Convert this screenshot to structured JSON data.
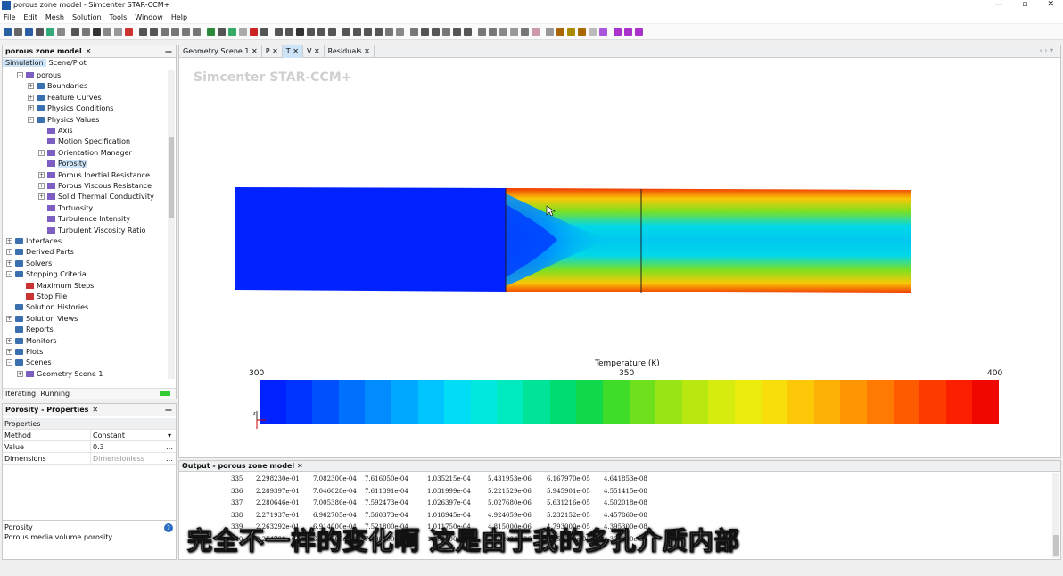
{
  "window": {
    "title": "porous zone model - Simcenter STAR-CCM+",
    "controls": [
      "—",
      "▫",
      "✕"
    ]
  },
  "menu": [
    "File",
    "Edit",
    "Mesh",
    "Solution",
    "Tools",
    "Window",
    "Help"
  ],
  "left_panel": {
    "tab": "porous zone model",
    "subtabs": [
      "Simulation",
      "Scene/Plot"
    ],
    "tree": [
      {
        "label": "porous",
        "indent": 1,
        "kind": "node",
        "expand": "-"
      },
      {
        "label": "Boundaries",
        "indent": 2,
        "kind": "folder",
        "expand": "+"
      },
      {
        "label": "Feature Curves",
        "indent": 2,
        "kind": "folder",
        "expand": "+"
      },
      {
        "label": "Physics Conditions",
        "indent": 2,
        "kind": "folder",
        "expand": "+"
      },
      {
        "label": "Physics Values",
        "indent": 2,
        "kind": "folder",
        "expand": "-"
      },
      {
        "label": "Axis",
        "indent": 3,
        "kind": "node",
        "expand": ""
      },
      {
        "label": "Motion Specification",
        "indent": 3,
        "kind": "node",
        "expand": ""
      },
      {
        "label": "Orientation Manager",
        "indent": 3,
        "kind": "node",
        "expand": "+"
      },
      {
        "label": "Porosity",
        "indent": 3,
        "kind": "node",
        "expand": "",
        "selected": true
      },
      {
        "label": "Porous Inertial Resistance",
        "indent": 3,
        "kind": "node",
        "expand": "+"
      },
      {
        "label": "Porous Viscous Resistance",
        "indent": 3,
        "kind": "node",
        "expand": "+"
      },
      {
        "label": "Solid Thermal Conductivity",
        "indent": 3,
        "kind": "node",
        "expand": "+"
      },
      {
        "label": "Tortuosity",
        "indent": 3,
        "kind": "node",
        "expand": ""
      },
      {
        "label": "Turbulence Intensity",
        "indent": 3,
        "kind": "node",
        "expand": ""
      },
      {
        "label": "Turbulent Viscosity Ratio",
        "indent": 3,
        "kind": "node",
        "expand": ""
      },
      {
        "label": "Interfaces",
        "indent": 0,
        "kind": "folder",
        "expand": "+"
      },
      {
        "label": "Derived Parts",
        "indent": 0,
        "kind": "folder",
        "expand": "+"
      },
      {
        "label": "Solvers",
        "indent": 0,
        "kind": "folder",
        "expand": "+"
      },
      {
        "label": "Stopping Criteria",
        "indent": 0,
        "kind": "folder",
        "expand": "-"
      },
      {
        "label": "Maximum Steps",
        "indent": 1,
        "kind": "alert",
        "expand": ""
      },
      {
        "label": "Stop File",
        "indent": 1,
        "kind": "alert",
        "expand": ""
      },
      {
        "label": "Solution Histories",
        "indent": 0,
        "kind": "folder",
        "expand": ""
      },
      {
        "label": "Solution Views",
        "indent": 0,
        "kind": "folder",
        "expand": "+"
      },
      {
        "label": "Reports",
        "indent": 0,
        "kind": "folder",
        "expand": ""
      },
      {
        "label": "Monitors",
        "indent": 0,
        "kind": "folder",
        "expand": "+"
      },
      {
        "label": "Plots",
        "indent": 0,
        "kind": "folder",
        "expand": "+"
      },
      {
        "label": "Scenes",
        "indent": 0,
        "kind": "folder",
        "expand": "-"
      },
      {
        "label": "Geometry Scene 1",
        "indent": 1,
        "kind": "node",
        "expand": "+"
      }
    ],
    "status": "Iterating: Running"
  },
  "properties_panel": {
    "tab": "Porosity - Properties",
    "section": "Properties",
    "rows": [
      {
        "key": "Method",
        "value": "Constant",
        "button": "▾"
      },
      {
        "key": "Value",
        "value": "0.3",
        "button": "…"
      },
      {
        "key": "Dimensions",
        "value": "Dimensionless",
        "button": "…"
      }
    ],
    "desc_title": "Porosity",
    "desc_text": "Porous media volume porosity"
  },
  "view_panel": {
    "tabs": [
      "Geometry Scene 1",
      "P",
      "T",
      "V",
      "Residuals"
    ],
    "active_tab": "T",
    "brand": "Simcenter STAR-CCM+",
    "colorbar": {
      "title": "Temperature (K)",
      "min": "300",
      "mid": "350",
      "max": "400",
      "colors": [
        "#0022ff",
        "#0033ff",
        "#0050ff",
        "#0070ff",
        "#008cff",
        "#00a8ff",
        "#00c4ff",
        "#00ddf5",
        "#00e8e0",
        "#00eac0",
        "#00e49a",
        "#00dd70",
        "#10d84a",
        "#40dc2a",
        "#6ee01c",
        "#98e414",
        "#b8e810",
        "#d6ec0e",
        "#ecec0c",
        "#f8de0a",
        "#fcc808",
        "#fdb006",
        "#fe9604",
        "#fe7a02",
        "#fe5a00",
        "#fd3a00",
        "#fc1e00",
        "#f00800"
      ]
    }
  },
  "output_panel": {
    "tab": "Output - porous zone model",
    "rows": [
      [
        "335",
        "2.298230e-01",
        "7.082300e-04",
        "7.616050e-04",
        "1.035215e-04",
        "5.431953e-06",
        "6.167970e-05",
        "4.641853e-08"
      ],
      [
        "336",
        "2.289397e-01",
        "7.046028e-04",
        "7.611391e-04",
        "1.031999e-04",
        "5.221529e-06",
        "5.945901e-05",
        "4.551415e-08"
      ],
      [
        "337",
        "2.280646e-01",
        "7.005386e-04",
        "7.592473e-04",
        "1.026397e-04",
        "5.027680e-06",
        "5.631216e-05",
        "4.502018e-08"
      ],
      [
        "338",
        "2.271937e-01",
        "6.962705e-04",
        "7.560373e-04",
        "1.018945e-04",
        "4.924059e-06",
        "5.232152e-05",
        "4.457860e-08"
      ],
      [
        "339",
        "2.263292e-01",
        "6.914000e-04",
        "7.521800e-04",
        "1.011750e-04",
        "4.815000e-06",
        "4.793000e-05",
        "4.395300e-08"
      ],
      [
        "340",
        "2.254700e-01",
        "6.862000e-04",
        "7.480000e-04",
        "1.003400e-04",
        "4.702000e-06",
        "4.351000e-05",
        "4.330000e-08"
      ]
    ]
  },
  "subtitle": "完全不一样的变化啊 这是由于我的多孔介质内部"
}
